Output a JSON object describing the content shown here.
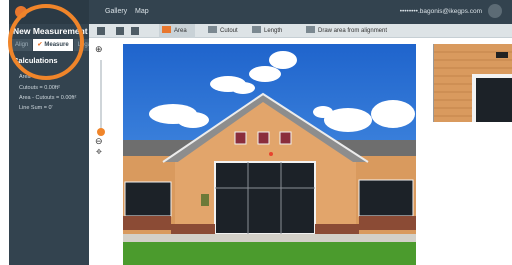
{
  "sidebar": {
    "title": "New Measurement",
    "steps": [
      {
        "label": "Align",
        "active": false
      },
      {
        "label": "Measure",
        "active": true
      },
      {
        "label": "Legal",
        "active": false
      }
    ],
    "calculations_title": "Calculations",
    "rows": [
      "Area",
      "Cutouts = 0.00ft²",
      "Area - Cutouts = 0.00ft²",
      "Line Sum = 0'"
    ]
  },
  "topbar": {
    "nav": [
      "Gallery",
      "Map"
    ],
    "email": "••••••••.bagonis@ikegps.com"
  },
  "toolbar": {
    "tools": [
      {
        "label": "Area",
        "icon": "area-icon"
      },
      {
        "label": "Cutout",
        "icon": "cutout-icon"
      },
      {
        "label": "Length",
        "icon": "length-icon"
      },
      {
        "label": "Draw area from alignment",
        "icon": "alignment-icon"
      }
    ]
  },
  "colors": {
    "accent": "#f0852a",
    "sidebar": "#33434f",
    "sky": "#2f7bd8",
    "siding": "#d99a5e"
  }
}
